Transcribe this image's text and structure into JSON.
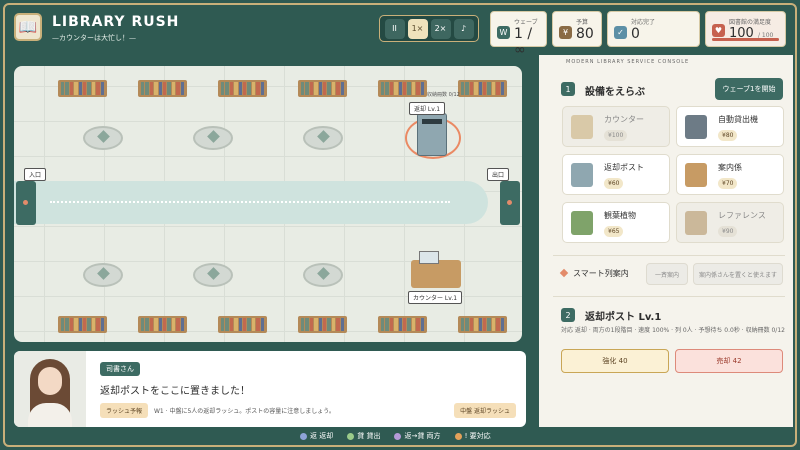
{
  "header": {
    "title": "LIBRARY RUSH",
    "subtitle": "—カウンターは大忙し！—",
    "logo_icon": "book-icon",
    "speed": {
      "pause": "II",
      "x1": "1×",
      "x2": "2×",
      "sound": "♪",
      "active": "1×"
    },
    "wave": {
      "label": "ウェーブ",
      "value": "1 / ∞",
      "icon": "W"
    },
    "budget": {
      "label": "予算",
      "value": "80",
      "icon": "¥"
    },
    "handled": {
      "label": "対応完了",
      "value": "0",
      "icon": "✓"
    },
    "satisfaction": {
      "label": "図書館の満足度",
      "value": "100",
      "max": "/ 100",
      "level": 1.0
    }
  },
  "map": {
    "entrance": "入口",
    "exit": "出口",
    "return_tag": "返却 Lv.1",
    "return_capacity": "収納冊数 0/12",
    "counter_tag": "カウンター Lv.1"
  },
  "dialogue": {
    "speaker": "司書さん",
    "text": "返却ポストをここに置きました！",
    "tip_badge": "ラッシュ予報",
    "tip_text": "W1 · 中盤に5人の返却ラッシュ。ポストの容量に注意しましょう。",
    "tip_right": "中盤 返却ラッシュ"
  },
  "panel": {
    "console_title": "MODERN LIBRARY SERVICE CONSOLE",
    "section1": {
      "step": "1",
      "title": "設備をえらぶ",
      "start_button": "ウェーブ1を開始"
    },
    "facilities": [
      {
        "name": "カウンター",
        "price": "¥100",
        "dim": true
      },
      {
        "name": "自動貸出機",
        "price": "¥80",
        "dim": false
      },
      {
        "name": "返却ポスト",
        "price": "¥60",
        "dim": false
      },
      {
        "name": "案内係",
        "price": "¥70",
        "dim": false
      },
      {
        "name": "観葉植物",
        "price": "¥65",
        "dim": false
      },
      {
        "name": "レファレンス",
        "price": "¥90",
        "dim": true
      }
    ],
    "smart_label": "スマート列案内",
    "smart_btn1": "一斉案内",
    "smart_btn2": "案内係さんを置くと使えます",
    "section2": {
      "step": "2",
      "title": "返却ポスト Lv.1"
    },
    "sel_info": "対応 返却 · 両方の1段階目 · 速度 100% · 列 0人 · 予想待ち 0.0秒 · 収納冊数 0/12",
    "upgrade": "強化 40",
    "sell": "売却 42"
  },
  "legend": [
    {
      "label": "返 返却",
      "color": "#8ea3d8"
    },
    {
      "label": "貸 貸出",
      "color": "#9acb8a"
    },
    {
      "label": "返→貸 両方",
      "color": "#b49ad8"
    },
    {
      "label": "! 要対応",
      "color": "#e3a15a"
    }
  ]
}
